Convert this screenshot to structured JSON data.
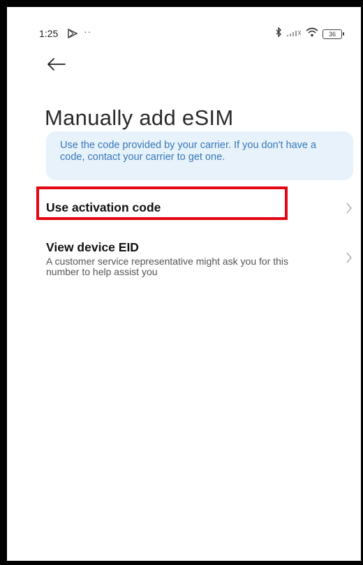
{
  "status_bar": {
    "time": "1:25",
    "dots": "··",
    "battery": "36"
  },
  "page": {
    "title": "Manually add eSIM"
  },
  "banner": {
    "text": "Use the code provided by your carrier. If you don't have a code, contact your carrier to get one."
  },
  "items": [
    {
      "title": "Use activation code",
      "subtitle": ""
    },
    {
      "title": "View device EID",
      "subtitle": "A customer service representative might ask you for this number to help assist you"
    }
  ],
  "colors": {
    "banner_bg": "#e7f2fb",
    "banner_text": "#3778b8",
    "highlight": "#e30613"
  },
  "icons": {
    "back": "arrow-left-icon",
    "chevron": "chevron-right-icon",
    "play": "play-store-icon",
    "bluetooth": "bluetooth-icon",
    "signal": "signal-icon",
    "wifi": "wifi-icon",
    "battery": "battery-icon"
  }
}
